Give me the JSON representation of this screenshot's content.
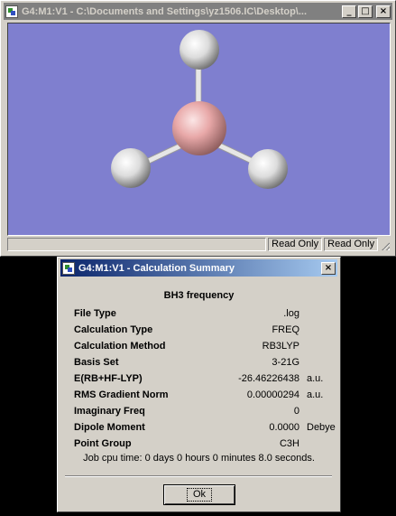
{
  "viewer": {
    "title": "G4:M1:V1 - C:\\Documents and Settings\\yz1506.IC\\Desktop\\...",
    "buttons": {
      "minimize": "_",
      "maximize": "□",
      "close": "×"
    },
    "canvas_color": "#7f7fcf",
    "molecule": {
      "center_atom": "B",
      "outer_atoms": [
        "H",
        "H",
        "H"
      ],
      "center_color": "#e8a8a8",
      "outer_color": "#e8e8e8"
    },
    "status": {
      "main": "",
      "field1": "Read Only",
      "field2": "Read Only"
    }
  },
  "dialog": {
    "title": "G4:M1:V1 - Calculation Summary",
    "close_label": "×",
    "heading": "BH3 frequency",
    "rows": [
      {
        "label": "File Type",
        "value": ".log",
        "unit": ""
      },
      {
        "label": "Calculation Type",
        "value": "FREQ",
        "unit": ""
      },
      {
        "label": "Calculation Method",
        "value": "RB3LYP",
        "unit": ""
      },
      {
        "label": "Basis Set",
        "value": "3-21G",
        "unit": ""
      },
      {
        "label": "E(RB+HF-LYP)",
        "value": "-26.46226438",
        "unit": "a.u."
      },
      {
        "label": "RMS Gradient Norm",
        "value": "0.00000294",
        "unit": "a.u."
      },
      {
        "label": "Imaginary Freq",
        "value": "0",
        "unit": ""
      },
      {
        "label": "Dipole Moment",
        "value": "0.0000",
        "unit": "Debye"
      },
      {
        "label": "Point Group",
        "value": "C3H",
        "unit": ""
      }
    ],
    "job_time": "Job cpu time:  0 days  0 hours  0 minutes  8.0 seconds.",
    "ok_label": "Ok"
  }
}
